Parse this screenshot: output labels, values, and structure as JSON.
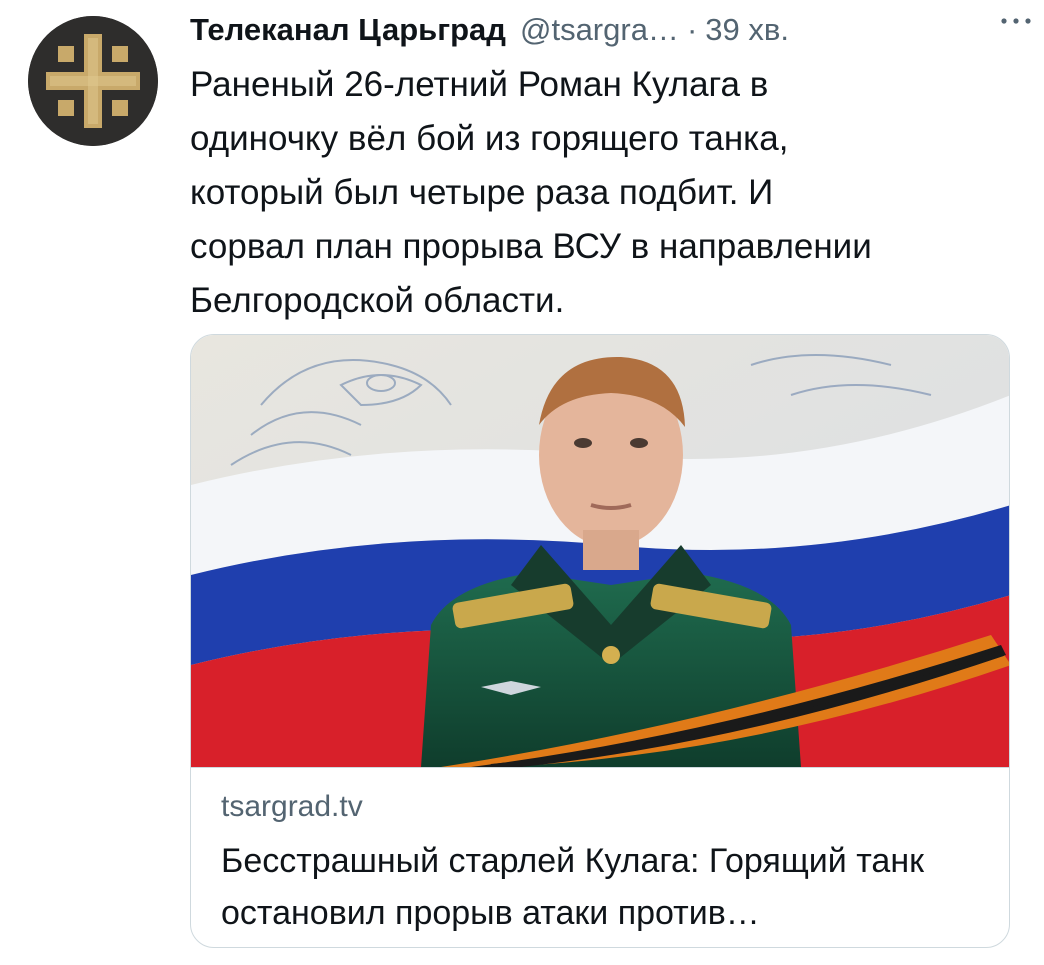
{
  "author": {
    "display_name": "Телеканал Царьград",
    "handle": "@tsargra…",
    "separator": "·",
    "time": "39 хв.",
    "avatar_icon": "cross-emblem-icon"
  },
  "more_icon": "more-options-icon",
  "tweet": {
    "text": "Раненый 26-летний Роман Кулага  в\nодиночку вёл бой из горящего танка,\nкоторый был четыре раза подбит.  И\nсорвал план прорыва ВСУ в направлении\nБелгородской области."
  },
  "card": {
    "image_alt": "portrait-with-flag-image",
    "domain": "tsargrad.tv",
    "title": "Бесстрашный старлей Кулага: Горящий танк остановил прорыв атаки против…"
  },
  "colors": {
    "text_primary": "#0f1419",
    "text_secondary": "#536471",
    "border": "#cfd9de",
    "avatar_bg": "#2e2d2c",
    "avatar_emblem": "#c8a96a"
  }
}
